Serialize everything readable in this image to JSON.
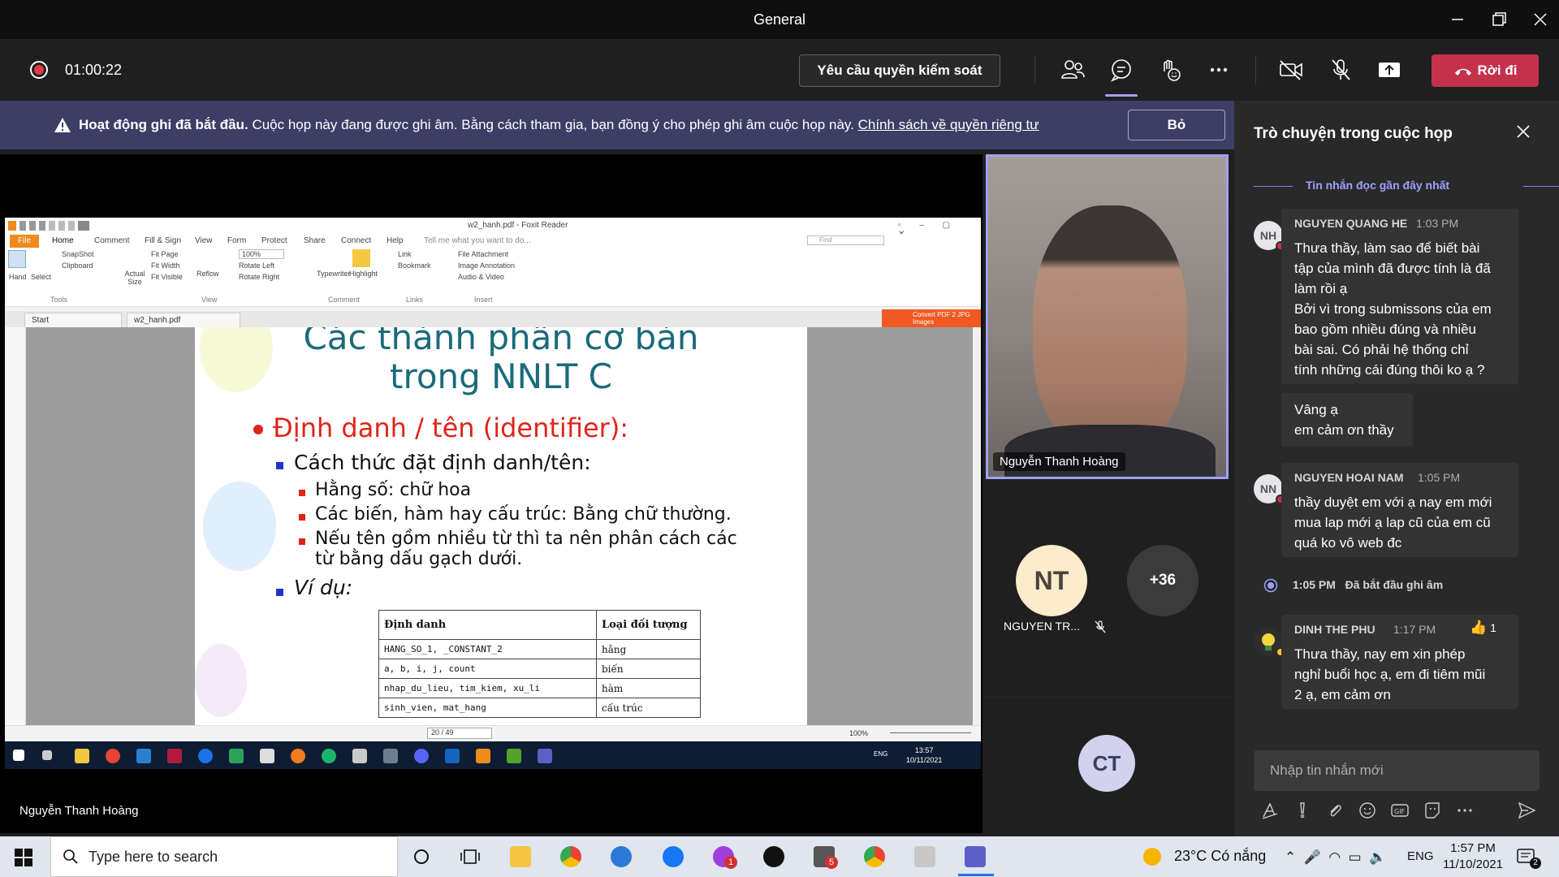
{
  "window": {
    "title": "General"
  },
  "toolbar": {
    "timer": "01:00:22",
    "request_control_label": "Yêu cầu quyền kiểm soát",
    "leave_label": "Rời đi"
  },
  "banner": {
    "bold_text": "Hoạt động ghi đã bắt đầu.",
    "text": " Cuộc họp này đang được ghi âm. Bằng cách tham gia, bạn đồng ý cho phép ghi âm cuộc họp này. ",
    "link_text": "Chính sách về quyền riêng tư",
    "dismiss_label": "Bỏ"
  },
  "shared_screen": {
    "presenter_name": "Nguyễn Thanh Hoàng",
    "foxit": {
      "window_title": "w2_hanh.pdf - Foxit Reader",
      "menu": [
        "File",
        "Home",
        "Comment",
        "Fill & Sign",
        "View",
        "Form",
        "Protect",
        "Share",
        "Connect",
        "Help"
      ],
      "tell_me": "Tell me what you want to do...",
      "find_placeholder": "Find",
      "ribbon": {
        "hand": "Hand",
        "select": "Select",
        "snapshot": "SnapShot",
        "clipboard": "Clipboard",
        "actual_size": "Actual Size",
        "fit_page": "Fit Page",
        "fit_width": "Fit Width",
        "fit_visible": "Fit Visible",
        "reflow": "Reflow",
        "zoom": "100%",
        "rotate_left": "Rotate Left",
        "rotate_right": "Rotate Right",
        "typewriter": "Typewriter",
        "highlight": "Highlight",
        "link": "Link",
        "bookmark": "Bookmark",
        "file_attachment": "File Attachment",
        "image_annotation": "Image Annotation",
        "audio_video": "Audio & Video",
        "group_tools": "Tools",
        "group_view": "View",
        "group_comment": "Comment",
        "group_links": "Links",
        "group_insert": "Insert"
      },
      "tabs": [
        "Start",
        "w2_hanh.pdf"
      ],
      "convert_label": "Convert PDF 2 JPG Images",
      "page_indicator": "20 / 49",
      "zoom_status": "100%"
    },
    "slide": {
      "title_line1": "Các thành phần cơ bản",
      "title_line2": "trong NNLT C",
      "bullet": "Định danh / tên (identifier):",
      "sub_bullet": "Cách thức đặt định danh/tên:",
      "items": [
        "Hằng số: chữ hoa",
        "Các biến, hàm hay cấu trúc: Bằng chữ thường.",
        "Nếu tên gồm nhiều từ thì ta nên phân cách các",
        "từ bằng dấu gạch dưới."
      ],
      "example": "Ví dụ:",
      "table": {
        "headers": [
          "Định danh",
          "Loại đối tượng"
        ],
        "rows": [
          [
            "HANG_SO_1, _CONSTANT_2",
            "hằng"
          ],
          [
            "a, b, i, j, count",
            "biến"
          ],
          [
            "nhap_du_lieu, tim_kiem, xu_li",
            "hàm"
          ],
          [
            "sinh_vien, mat_hang",
            "cấu trúc"
          ]
        ]
      }
    },
    "remote_taskbar": {
      "time": "13:57",
      "date": "10/11/2021",
      "lang": "ENG"
    }
  },
  "participants": {
    "video_name": "Nguyễn Thanh Hoàng",
    "nt_initials": "NT",
    "nt_name": "NGUYEN TR...",
    "more_count": "+36",
    "ct_initials": "CT"
  },
  "chat": {
    "header": "Trò chuyện trong cuộc họp",
    "recent_label": "Tin nhắn đọc gần đây nhất",
    "messages": [
      {
        "initials": "NH",
        "sender": "NGUYEN QUANG HE",
        "time": "1:03 PM",
        "lines": [
          "Thưa thầy, làm sao để biết bài",
          "tập của mình đã được tính là đã",
          "làm rồi ạ",
          "Bởi vì trong submissons của em",
          "bao gồm nhiều đúng và nhiều",
          "bài sai. Có phải hệ thống chỉ",
          "tính những cái đúng thôi ko ạ ?"
        ]
      },
      {
        "lines": [
          "Vâng ạ",
          "em cảm ơn thầy"
        ]
      },
      {
        "initials": "NN",
        "sender": "NGUYEN HOAI NAM",
        "time": "1:05 PM",
        "lines": [
          "thầy duyệt em với ạ nay em mới",
          "mua lap mới ạ lap cũ của em cũ",
          "quá ko vô web đc"
        ]
      },
      {
        "sender": "DINH THE PHU",
        "time": "1:17 PM",
        "reaction_count": "1",
        "lines": [
          "Thưa thầy, nay em xin phép",
          "nghỉ buổi học ạ, em đi tiêm mũi",
          "2 ạ, em cảm ơn"
        ]
      }
    ],
    "system_time": "1:05 PM",
    "system_text": "Đã bắt đầu ghi âm",
    "compose_placeholder": "Nhập tin nhắn mới"
  },
  "taskbar": {
    "search_placeholder": "Type here to search",
    "weather": "23°C  Có nắng",
    "lang": "ENG",
    "time": "1:57 PM",
    "date": "11/10/2021",
    "notif_count": "2",
    "badge_video": "1",
    "badge_mail": "5"
  },
  "colors": {
    "accent": "#9ea2ff",
    "leave": "#c4314b",
    "banner": "#3d3e66",
    "slide_title": "#1a6a7a",
    "slide_red": "#e02418"
  }
}
